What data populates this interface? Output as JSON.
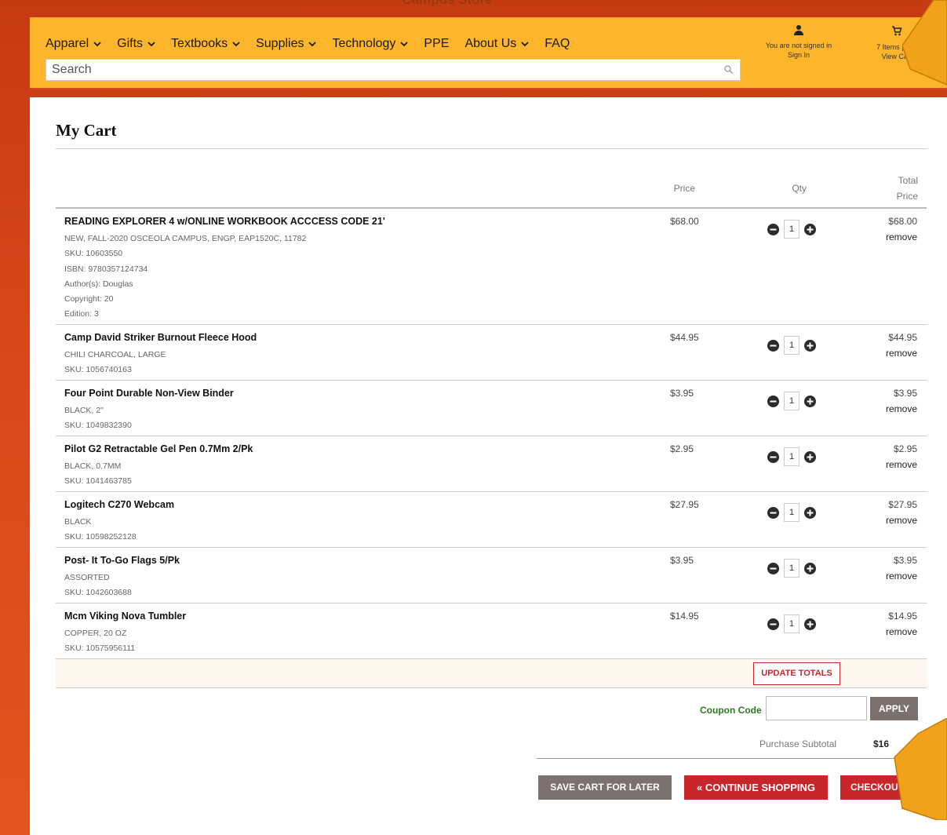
{
  "store_title": "Campus Store",
  "nav": {
    "items": [
      {
        "label": "Apparel",
        "dropdown": true
      },
      {
        "label": "Gifts",
        "dropdown": true
      },
      {
        "label": "Textbooks",
        "dropdown": true
      },
      {
        "label": "Supplies",
        "dropdown": true
      },
      {
        "label": "Technology",
        "dropdown": true
      },
      {
        "label": "PPE",
        "dropdown": false
      },
      {
        "label": "About Us",
        "dropdown": true
      },
      {
        "label": "FAQ",
        "dropdown": false
      }
    ],
    "chevron_glyph": "⌄"
  },
  "search": {
    "value": "Search",
    "placeholder": "Search",
    "icon": "search-icon"
  },
  "account": {
    "status": "You are not signed in",
    "sign_in": "Sign In",
    "icon": "person-icon"
  },
  "cart_summary": {
    "items": "7 Items | $16",
    "view_cart": "View Cart",
    "icon": "cart-icon"
  },
  "page": {
    "title": "My Cart"
  },
  "table": {
    "headers": {
      "price": "Price",
      "qty": "Qty",
      "total_line1": "Total",
      "total_line2": "Price"
    },
    "remove_label": "remove",
    "rows": [
      {
        "name": "READING EXPLORER 4 w/ONLINE WORKBOOK ACCCESS CODE 21'",
        "details": [
          "NEW, FALL-2020 OSCEOLA CAMPUS, ENGP, EAP1520C, 11782",
          "SKU: 10603550",
          "ISBN: 9780357124734",
          "Author(s): Douglas",
          "Copyright: 20",
          "Edition: 3"
        ],
        "price": "$68.00",
        "qty": "1",
        "total": "$68.00"
      },
      {
        "name": "Camp David Striker Burnout Fleece Hood",
        "details": [
          "CHILI CHARCOAL, LARGE",
          "SKU: 1056740163"
        ],
        "price": "$44.95",
        "qty": "1",
        "total": "$44.95"
      },
      {
        "name": "Four Point Durable Non-View Binder",
        "details": [
          "BLACK, 2\"",
          "SKU: 1049832390"
        ],
        "price": "$3.95",
        "qty": "1",
        "total": "$3.95"
      },
      {
        "name": "Pilot G2 Retractable Gel Pen 0.7Mm 2/Pk",
        "details": [
          "BLACK, 0.7MM",
          "SKU: 1041463785"
        ],
        "price": "$2.95",
        "qty": "1",
        "total": "$2.95"
      },
      {
        "name": "Logitech C270 Webcam",
        "details": [
          "BLACK",
          "SKU: 10598252128"
        ],
        "price": "$27.95",
        "qty": "1",
        "total": "$27.95"
      },
      {
        "name": "Post- It To-Go Flags 5/Pk",
        "details": [
          "ASSORTED",
          "SKU: 1042603688"
        ],
        "price": "$3.95",
        "qty": "1",
        "total": "$3.95"
      },
      {
        "name": "Mcm Viking Nova Tumbler",
        "details": [
          "COPPER, 20 OZ",
          "SKU: 10575956111"
        ],
        "price": "$14.95",
        "qty": "1",
        "total": "$14.95"
      }
    ]
  },
  "actions": {
    "update_totals": "UPDATE TOTALS",
    "coupon_label": "Coupon Code",
    "coupon_value": "",
    "apply": "APPLY",
    "subtotal_label": "Purchase Subtotal",
    "subtotal_value": "$16",
    "save_for_later": "SAVE CART FOR LATER",
    "continue_shopping": "« CONTINUE SHOPPING",
    "checkout": "CHECKOUT »"
  },
  "colors": {
    "header_bg": "#fdb52b",
    "frame_bg": "#d9461b",
    "accent_red": "#c9262c",
    "button_gray": "#7d7170",
    "coupon_green": "#2a7a1e",
    "arrow": "#f0a21a"
  }
}
